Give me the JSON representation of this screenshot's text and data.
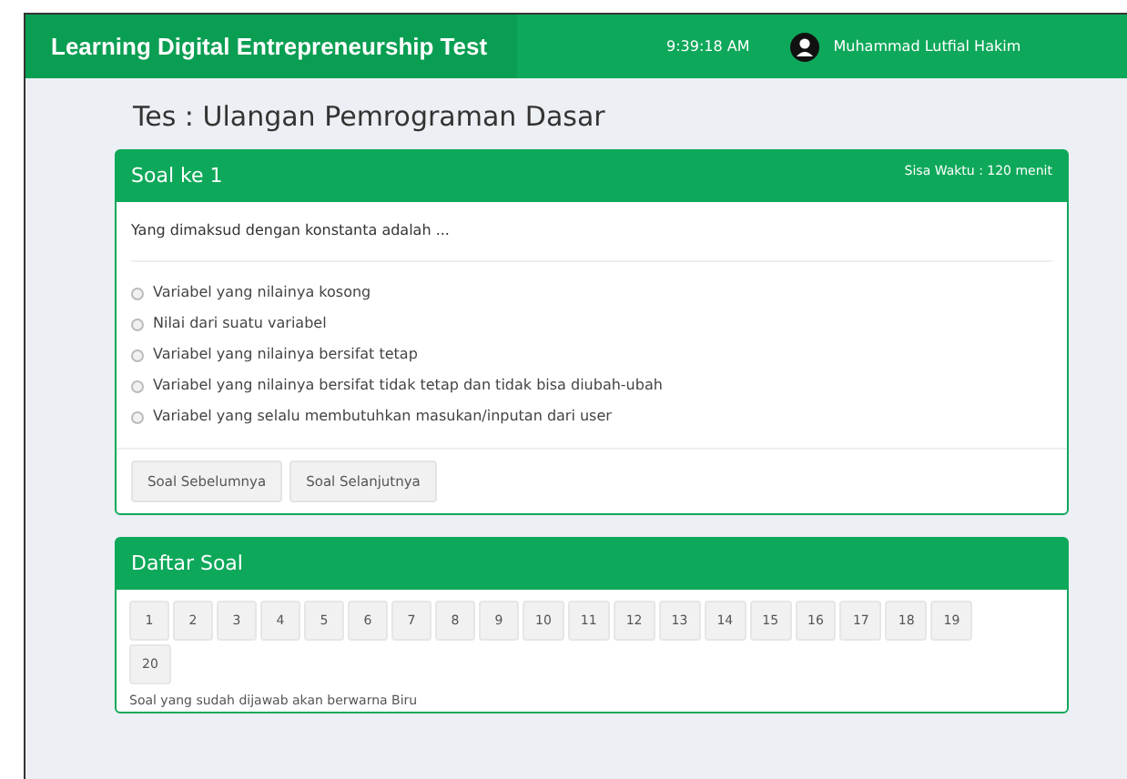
{
  "header": {
    "title": "Learning Digital Entrepreneurship Test",
    "time": "9:39:18 AM",
    "user": "Muhammad Lutfial Hakim"
  },
  "page_title": "Tes : Ulangan Pemrograman Dasar",
  "question_card": {
    "title": "Soal ke 1",
    "timer": "Sisa Waktu : 120 menit",
    "question": "Yang dimaksud dengan konstanta adalah ...",
    "options": [
      {
        "label": "Variabel yang nilainya kosong",
        "selected": false
      },
      {
        "label": "Nilai dari suatu variabel",
        "selected": false
      },
      {
        "label": "Variabel yang nilainya bersifat tetap",
        "selected": false
      },
      {
        "label": "Variabel yang nilainya bersifat tidak tetap dan tidak bisa diubah-ubah",
        "selected": false
      },
      {
        "label": "Variabel yang selalu membutuhkan masukan/inputan dari user",
        "selected": false
      }
    ],
    "buttons": [
      "Soal Sebelumnya",
      "Soal Selanjutnya"
    ]
  },
  "question_list": {
    "title": "Daftar Soal",
    "numbers": [
      "1",
      "2",
      "3",
      "4",
      "5",
      "6",
      "7",
      "8",
      "9",
      "10",
      "11",
      "12",
      "13",
      "14",
      "15",
      "16",
      "17",
      "18",
      "19",
      "20"
    ],
    "note": "Soal yang sudah dijawab akan berwarna Biru"
  }
}
